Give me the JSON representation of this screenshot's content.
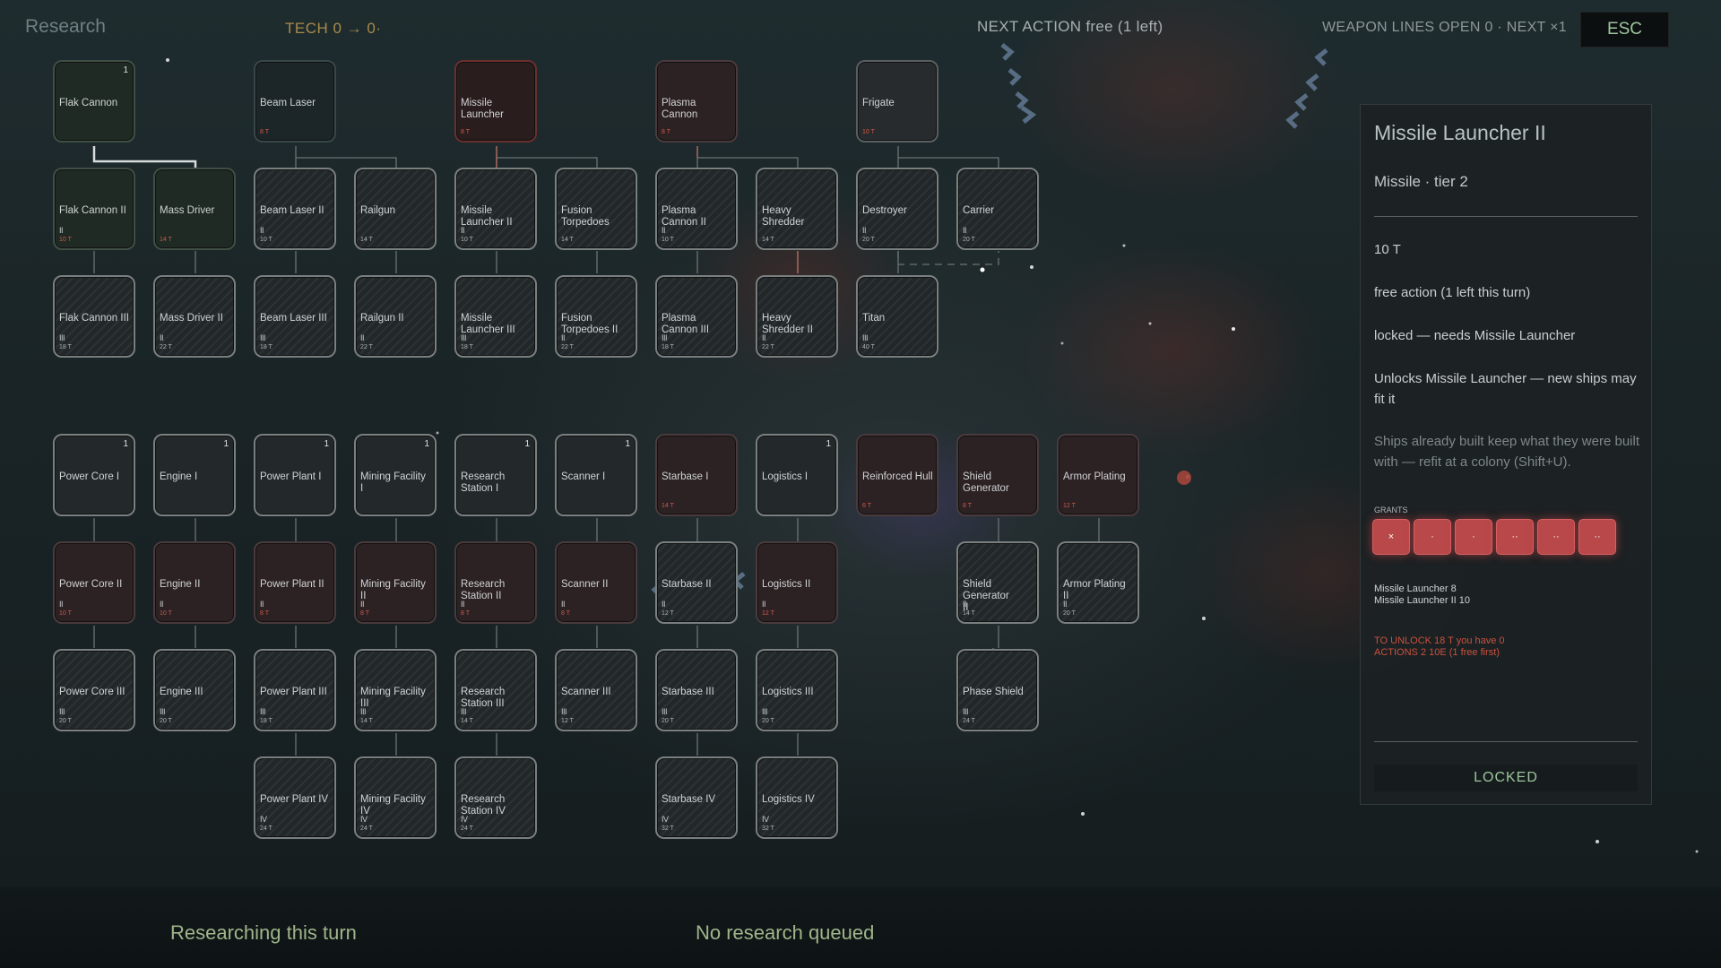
{
  "header": {
    "title": "Research",
    "tech": "TECH  0 → 0·",
    "next_action": "NEXT ACTION   free  (1 left)",
    "weapon_lines": "WEAPON LINES OPEN 0 · NEXT ×1",
    "esc_label": "ESC"
  },
  "nodes": {
    "flak1": {
      "name": "Flak Cannon",
      "num": "1",
      "tier": "",
      "cost": ""
    },
    "beam1": {
      "name": "Beam Laser",
      "num": "",
      "tier": "",
      "cost": "8 T"
    },
    "missile1": {
      "name": "Missile Launcher",
      "num": "",
      "tier": "",
      "cost": "8 T"
    },
    "plasma1": {
      "name": "Plasma Cannon",
      "num": "",
      "tier": "",
      "cost": "8 T"
    },
    "frigate": {
      "name": "Frigate",
      "num": "",
      "tier": "",
      "cost": "10 T"
    },
    "flak2": {
      "name": "Flak Cannon II",
      "num": "",
      "tier": "II",
      "cost": "10 T"
    },
    "massdriver": {
      "name": "Mass Driver",
      "num": "",
      "tier": "",
      "cost": "14 T"
    },
    "beam2": {
      "name": "Beam Laser II",
      "num": "",
      "tier": "II",
      "cost": "10 T"
    },
    "railgun": {
      "name": "Railgun",
      "num": "",
      "tier": "",
      "cost": "14 T"
    },
    "missile2": {
      "name": "Missile Launcher II",
      "num": "",
      "tier": "II",
      "cost": "10 T"
    },
    "fusion1": {
      "name": "Fusion Torpedoes",
      "num": "",
      "tier": "",
      "cost": "14 T"
    },
    "plasma2": {
      "name": "Plasma Cannon II",
      "num": "",
      "tier": "II",
      "cost": "10 T"
    },
    "heavy1": {
      "name": "Heavy Shredder",
      "num": "",
      "tier": "",
      "cost": "14 T"
    },
    "destroyer": {
      "name": "Destroyer",
      "num": "",
      "tier": "II",
      "cost": "20 T"
    },
    "carrier": {
      "name": "Carrier",
      "num": "",
      "tier": "II",
      "cost": "20 T"
    },
    "flak3": {
      "name": "Flak Cannon III",
      "num": "",
      "tier": "III",
      "cost": "18 T"
    },
    "massdriver2": {
      "name": "Mass Driver II",
      "num": "",
      "tier": "II",
      "cost": "22 T"
    },
    "beam3": {
      "name": "Beam Laser III",
      "num": "",
      "tier": "III",
      "cost": "18 T"
    },
    "railgun2": {
      "name": "Railgun II",
      "num": "",
      "tier": "II",
      "cost": "22 T"
    },
    "missile3": {
      "name": "Missile Launcher III",
      "num": "",
      "tier": "III",
      "cost": "18 T"
    },
    "fusion2": {
      "name": "Fusion Torpedoes II",
      "num": "",
      "tier": "II",
      "cost": "22 T"
    },
    "plasma3": {
      "name": "Plasma Cannon III",
      "num": "",
      "tier": "III",
      "cost": "18 T"
    },
    "heavy2": {
      "name": "Heavy Shredder II",
      "num": "",
      "tier": "II",
      "cost": "22 T"
    },
    "titan": {
      "name": "Titan",
      "num": "",
      "tier": "III",
      "cost": "40 T"
    },
    "power1": {
      "name": "Power Core I",
      "num": "1",
      "tier": "",
      "cost": ""
    },
    "engine1": {
      "name": "Engine I",
      "num": "1",
      "tier": "",
      "cost": ""
    },
    "plant1": {
      "name": "Power Plant I",
      "num": "1",
      "tier": "",
      "cost": ""
    },
    "mining1": {
      "name": "Mining Facility I",
      "num": "1",
      "tier": "",
      "cost": ""
    },
    "research1": {
      "name": "Research Station I",
      "num": "1",
      "tier": "",
      "cost": ""
    },
    "scanner1": {
      "name": "Scanner I",
      "num": "1",
      "tier": "",
      "cost": ""
    },
    "starbase1": {
      "name": "Starbase I",
      "num": "",
      "tier": "",
      "cost": "14 T"
    },
    "logistics1": {
      "name": "Logistics I",
      "num": "1",
      "tier": "",
      "cost": ""
    },
    "hull": {
      "name": "Reinforced Hull",
      "num": "",
      "tier": "",
      "cost": "6 T"
    },
    "shield1": {
      "name": "Shield Generator",
      "num": "",
      "tier": "",
      "cost": "8 T"
    },
    "armor1": {
      "name": "Armor Plating",
      "num": "",
      "tier": "",
      "cost": "12 T"
    },
    "power2": {
      "name": "Power Core II",
      "num": "",
      "tier": "II",
      "cost": "10 T"
    },
    "engine2": {
      "name": "Engine II",
      "num": "",
      "tier": "II",
      "cost": "10 T"
    },
    "plant2": {
      "name": "Power Plant II",
      "num": "",
      "tier": "II",
      "cost": "8 T"
    },
    "mining2": {
      "name": "Mining Facility II",
      "num": "",
      "tier": "II",
      "cost": "8 T"
    },
    "research2": {
      "name": "Research Station II",
      "num": "",
      "tier": "II",
      "cost": "8 T"
    },
    "scanner2": {
      "name": "Scanner II",
      "num": "",
      "tier": "II",
      "cost": "8 T"
    },
    "starbase2": {
      "name": "Starbase II",
      "num": "",
      "tier": "II",
      "cost": "12 T"
    },
    "logistics2": {
      "name": "Logistics II",
      "num": "",
      "tier": "II",
      "cost": "12 T"
    },
    "shield2": {
      "name": "Shield Generator II",
      "num": "",
      "tier": "II",
      "cost": "14 T"
    },
    "armor2": {
      "name": "Armor Plating II",
      "num": "",
      "tier": "II",
      "cost": "20 T"
    },
    "power3": {
      "name": "Power Core III",
      "num": "",
      "tier": "III",
      "cost": "20 T"
    },
    "engine3": {
      "name": "Engine III",
      "num": "",
      "tier": "III",
      "cost": "20 T"
    },
    "plant3": {
      "name": "Power Plant III",
      "num": "",
      "tier": "III",
      "cost": "18 T"
    },
    "mining3": {
      "name": "Mining Facility III",
      "num": "",
      "tier": "III",
      "cost": "14 T"
    },
    "research3": {
      "name": "Research Station III",
      "num": "",
      "tier": "III",
      "cost": "14 T"
    },
    "scanner3": {
      "name": "Scanner III",
      "num": "",
      "tier": "III",
      "cost": "12 T"
    },
    "starbase3": {
      "name": "Starbase III",
      "num": "",
      "tier": "III",
      "cost": "20 T"
    },
    "logistics3": {
      "name": "Logistics III",
      "num": "",
      "tier": "III",
      "cost": "20 T"
    },
    "phase": {
      "name": "Phase Shield",
      "num": "",
      "tier": "III",
      "cost": "24 T"
    },
    "plant4": {
      "name": "Power Plant IV",
      "num": "",
      "tier": "IV",
      "cost": "24 T"
    },
    "mining4": {
      "name": "Mining Facility IV",
      "num": "",
      "tier": "IV",
      "cost": "24 T"
    },
    "research4": {
      "name": "Research Station IV",
      "num": "",
      "tier": "IV",
      "cost": "24 T"
    },
    "starbase4": {
      "name": "Starbase IV",
      "num": "",
      "tier": "IV",
      "cost": "32 T"
    },
    "logistics4": {
      "name": "Logistics IV",
      "num": "",
      "tier": "IV",
      "cost": "32 T"
    }
  },
  "panel": {
    "title": "Missile Launcher II",
    "subtitle": "Missile  ·  tier 2",
    "cost": "10 T",
    "action": "free action  (1 left this turn)",
    "locked_reason": "locked — needs Missile Launcher",
    "unlocks": "Unlocks Missile Launcher — new ships may fit it",
    "note": "Ships already built keep what they were built with — refit at a colony (Shift+U).",
    "grants_label": "GRANTS",
    "slots": [
      "×",
      "·",
      "·",
      "··",
      "··",
      "··"
    ],
    "grants_line1": "Missile Launcher   8",
    "grants_line2": "Missile Launcher II   10",
    "to_unlock": "TO UNLOCK   18 T      you have 0",
    "actions": "ACTIONS   2      10E (1 free first)",
    "locked_button": "LOCKED"
  },
  "footer": {
    "researching": "Researching this turn",
    "queue": "No research queued"
  },
  "colors": {
    "accent_green": "#9fb58a",
    "warning_red": "#c9513f",
    "slot_red": "#b8484a"
  }
}
